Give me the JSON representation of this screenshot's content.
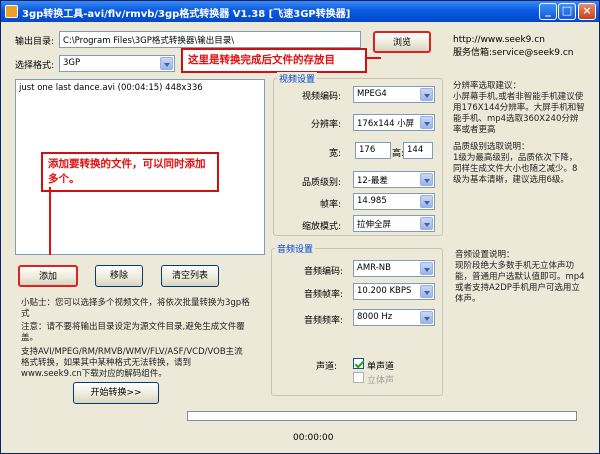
{
  "window": {
    "title": "3gp转换工具-avi/flv/rmvb/3gp格式转换器 V1.38 [飞速3GP转换器]",
    "controls": {
      "minimize": "_",
      "maximize": "□",
      "close": "×"
    }
  },
  "output": {
    "label": "输出目录:",
    "value": "C:\\Program Files\\3GP格式转换器\\输出目录\\",
    "browse_label": "浏览"
  },
  "format": {
    "label": "选择格式:",
    "value": "3GP"
  },
  "file_list": [
    "just one last dance.avi (00:04:15) 448x336"
  ],
  "callouts": {
    "save_dir": "这里是转换完成后文件的存放目",
    "add_files": "添加要转换的文件，可以同时添加多个。"
  },
  "buttons": {
    "add": "添加",
    "remove": "移除",
    "clear": "清空列表",
    "start": "开始转换>>"
  },
  "tips": {
    "tip1": "小贴士：您可以选择多个视频文件，将依次批量转换为3gp格式",
    "tip2": "注意：请不要将输出目录设定为源文件目录,避免生成文件覆盖。",
    "tip3": "支持AVI/MPEG/RM/RMVB/WMV/FLV/ASF/VCD/VOB主流格式转换，如果其中某种格式无法转换，请到www.seek9.cn下载对应的解码组件。"
  },
  "video": {
    "group_title": "视频设置",
    "codec_label": "视频编码:",
    "codec_value": "MPEG4",
    "resolution_label": "分辨率:",
    "resolution_value": "176x144 小屏",
    "width_label": "宽:",
    "width_value": "176",
    "height_label": "高:",
    "height_value": "144",
    "quality_label": "品质级别:",
    "quality_value": "12-最差",
    "fps_label": "帧率:",
    "fps_value": "14.985",
    "scale_label": "缩放模式:",
    "scale_value": "拉伸全屏"
  },
  "audio": {
    "group_title": "音频设置",
    "codec_label": "音频编码:",
    "codec_value": "AMR-NB",
    "rate_label": "音频帧率:",
    "rate_value": "10.200 KBPS",
    "freq_label": "音频频率:",
    "freq_value": "8000 Hz",
    "channel_label": "声道:",
    "mono_label": "单声道",
    "stereo_label": "立体声"
  },
  "right_info": {
    "url": "http://www.seek9.cn",
    "email": "服务信箱:service@seek9.cn",
    "res_title": "分辨率选取建议：",
    "res_text": "小屏幕手机,或者非智能手机建议使用176X144分辨率。大屏手机和智能手机、mp4选取360X240分辨率或者更高",
    "quality_title": "品质级别选取说明：",
    "quality_text": "1级为最高级别，品质依次下降，同样生成文件大小也随之减少。8级为基本清晰，建议选用6级。",
    "audio_title": "音频设置说明：",
    "audio_text": "现阶段绝大多数手机无立体声功能，普通用户选默认值即可。mp4或者支持A2DP手机用户可选用立体声。"
  },
  "status": {
    "time": "00:00:00"
  }
}
